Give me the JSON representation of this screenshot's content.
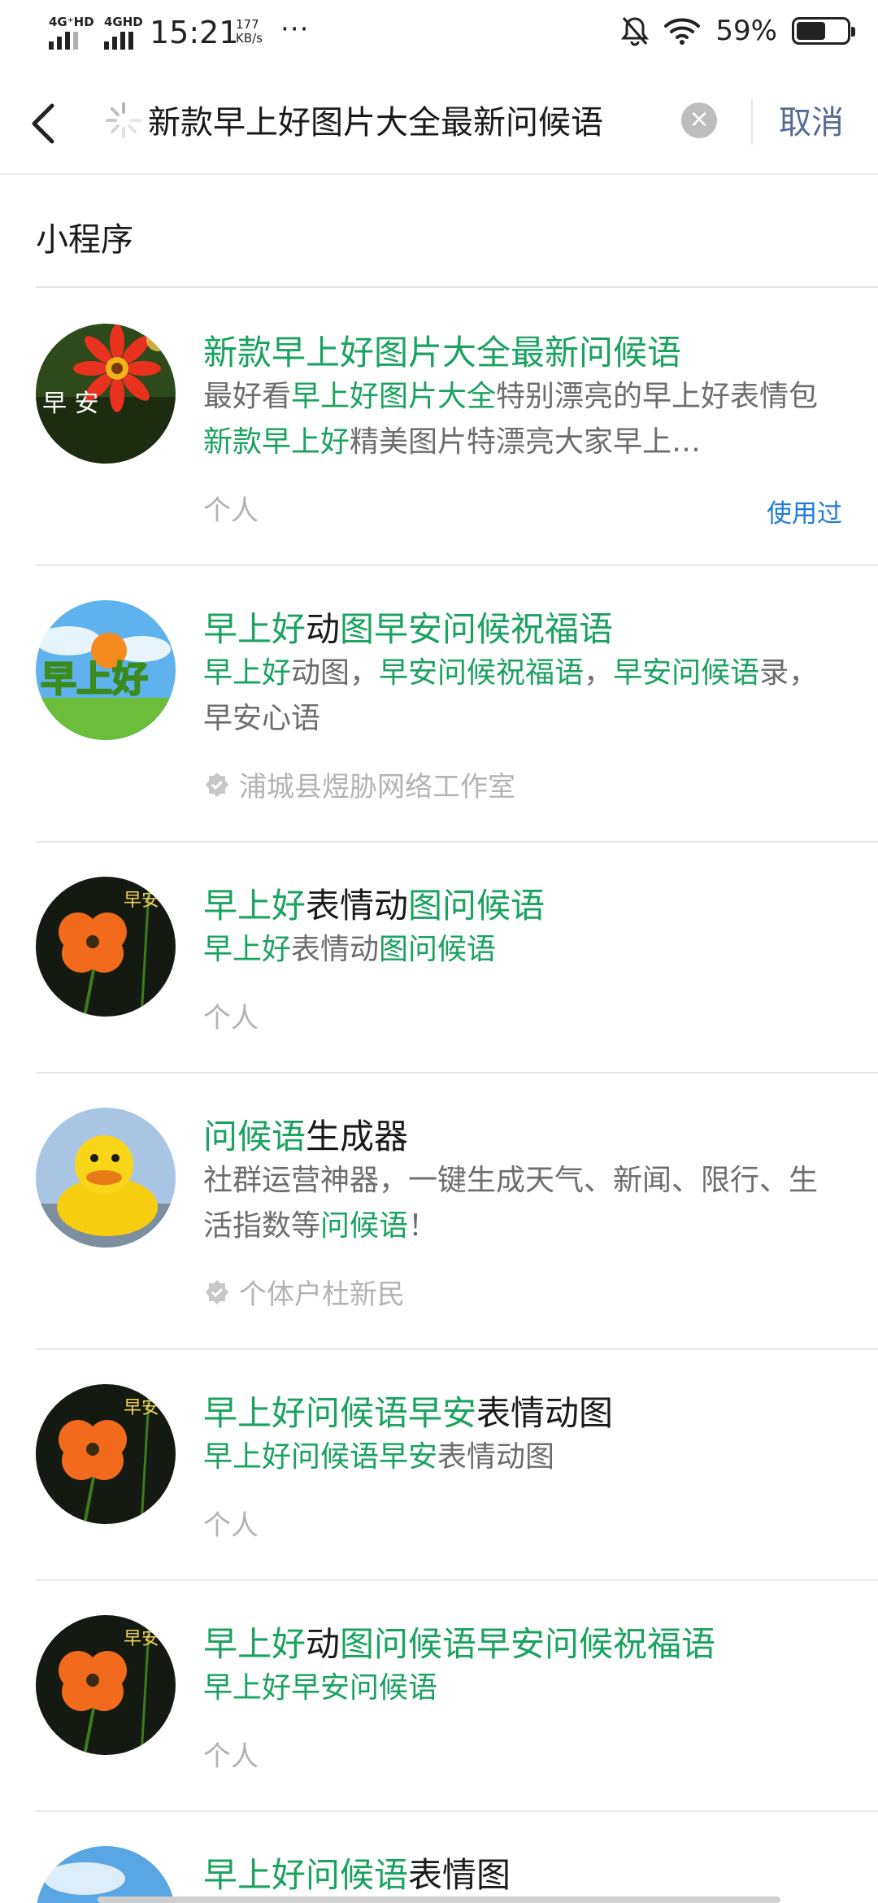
{
  "status_bar": {
    "network_1": "4G⁺HD",
    "network_2": "4GHD",
    "time": "15:21",
    "speed_value": "177",
    "speed_unit": "KB/s",
    "more": "···",
    "battery": "59%",
    "battery_level": 0.59
  },
  "search": {
    "query": "新款早上好图片大全最新问候语",
    "cancel_label": "取消"
  },
  "section_title": "小程序",
  "results": [
    {
      "title": [
        [
          "新款早上好图片大全最新问候语",
          true
        ]
      ],
      "desc": [
        [
          "最好看",
          false
        ],
        [
          "早上好图片大全",
          true
        ],
        [
          "特别漂亮的早上好表情包",
          false
        ],
        [
          "新款早上好",
          true
        ],
        [
          "精美图片特漂亮大家早上…",
          false
        ]
      ],
      "owner": "个人",
      "verified": false,
      "used_label": "使用过",
      "avatar_text": "早 安"
    },
    {
      "title": [
        [
          "早上好",
          true
        ],
        [
          "动",
          false
        ],
        [
          "图早安问候祝福语",
          true
        ]
      ],
      "desc": [
        [
          "早上好",
          true
        ],
        [
          "动图，",
          false
        ],
        [
          "早安问候祝福语",
          true
        ],
        [
          "，",
          false
        ],
        [
          "早安问候语",
          true
        ],
        [
          "录，早安心语",
          false
        ]
      ],
      "owner": "浦城县煜胁网络工作室",
      "verified": true,
      "avatar_text": "早上好"
    },
    {
      "title": [
        [
          "早上好",
          true
        ],
        [
          "表情动",
          false
        ],
        [
          "图问候语",
          true
        ]
      ],
      "desc": [
        [
          "早上好",
          true
        ],
        [
          "表情动",
          false
        ],
        [
          "图问候语",
          true
        ]
      ],
      "owner": "个人",
      "verified": false,
      "avatar_text": "早安"
    },
    {
      "title": [
        [
          "问候语",
          true
        ],
        [
          "生成器",
          false
        ]
      ],
      "desc": [
        [
          "社群运营神器，一键生成天气、新闻、限行、生活指数等",
          false
        ],
        [
          "问候语",
          true
        ],
        [
          "！",
          false
        ]
      ],
      "owner": "个体户杜新民",
      "verified": true,
      "avatar_text": ""
    },
    {
      "title": [
        [
          "早上好问候语早安",
          true
        ],
        [
          "表情动图",
          false
        ]
      ],
      "desc": [
        [
          "早上好问候语早安",
          true
        ],
        [
          "表情动图",
          false
        ]
      ],
      "owner": "个人",
      "verified": false,
      "avatar_text": "早安"
    },
    {
      "title": [
        [
          "早上好",
          true
        ],
        [
          "动",
          false
        ],
        [
          "图问候语早安问候祝福语",
          true
        ]
      ],
      "desc": [
        [
          "早上好早安问候语",
          true
        ]
      ],
      "owner": "个人",
      "verified": false,
      "avatar_text": "早安"
    },
    {
      "title": [
        [
          "早上好问候语",
          true
        ],
        [
          "表情图",
          false
        ]
      ],
      "desc": [],
      "owner": "",
      "verified": false,
      "avatar_text": ""
    }
  ],
  "colors": {
    "highlight": "#1aa260",
    "link_blue": "#1f7bd8",
    "cancel": "#576b95"
  }
}
